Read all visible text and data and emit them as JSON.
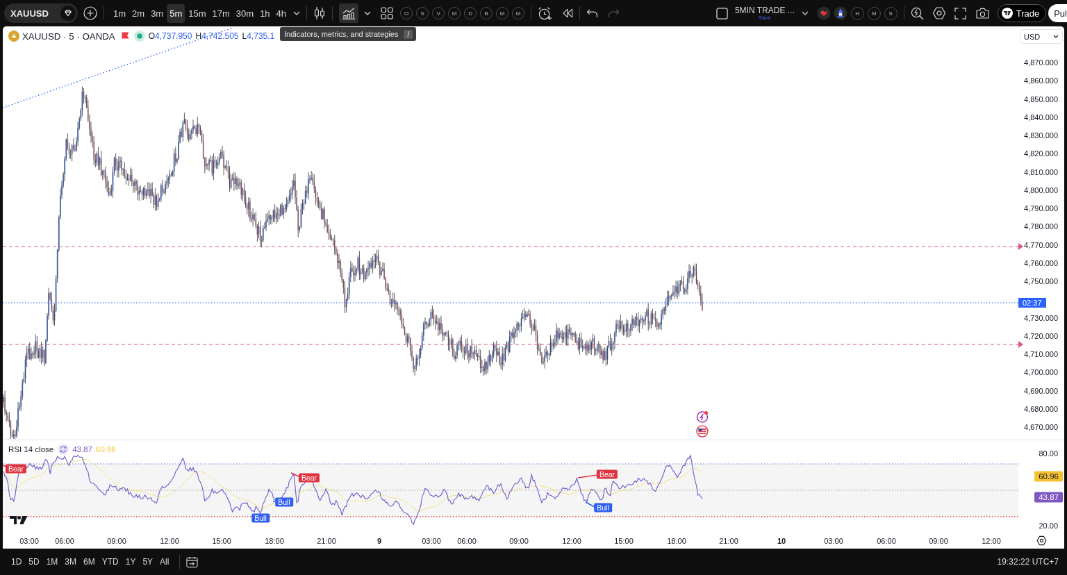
{
  "toolbar": {
    "symbol": "XAUUSD",
    "intervals": [
      {
        "label": "1m",
        "selected": false
      },
      {
        "label": "2m",
        "selected": false
      },
      {
        "label": "3m",
        "selected": false
      },
      {
        "label": "5m",
        "selected": true
      },
      {
        "label": "15m",
        "selected": false
      },
      {
        "label": "17m",
        "selected": false
      },
      {
        "label": "30m",
        "selected": false
      },
      {
        "label": "1h",
        "selected": false
      },
      {
        "label": "4h",
        "selected": false
      }
    ],
    "indicators": {
      "hovered": true
    },
    "favorites": [
      "O",
      "S",
      "V",
      "M",
      "D",
      "B",
      "M",
      "M"
    ],
    "history": {
      "undo_disabled": false,
      "redo_disabled": true
    },
    "layout": {
      "name": "5MIN TRADE ...",
      "status": "Save"
    },
    "profiles": [
      "H",
      "M",
      "S"
    ],
    "trade_button": "Trade",
    "publish_button": "Pul"
  },
  "tooltip": {
    "text": "Indicators, metrics, and strategies",
    "shortcut": "/"
  },
  "legend": {
    "title": "XAUUSD · 5 · OANDA",
    "market_open": true,
    "ohlc": [
      {
        "key": "O",
        "value": "4,737.950"
      },
      {
        "key": "H",
        "value": "4,742.505"
      },
      {
        "key": "L",
        "value": "4,735.1"
      }
    ]
  },
  "currency": "USD",
  "price_axis": {
    "labels": [
      "4,870.000",
      "4,860.000",
      "4,850.000",
      "4,840.000",
      "4,830.000",
      "4,820.000",
      "4,810.000",
      "4,800.000",
      "4,790.000",
      "4,780.000",
      "4,770.000",
      "4,760.000",
      "4,750.000",
      "4,730.000",
      "4,720.000",
      "4,710.000",
      "4,700.000",
      "4,690.000",
      "4,680.000",
      "4,670.000"
    ],
    "countdown": "02:37"
  },
  "rsi": {
    "title": "RSI 14 close",
    "values": [
      {
        "text": "43.87",
        "color": "#7e57c2"
      },
      {
        "text": "60.96",
        "color": "#f2c230"
      }
    ],
    "axis": [
      {
        "text": "80.00",
        "kind": "tick"
      },
      {
        "text": "60.96",
        "kind": "value",
        "color": "#f2c230"
      },
      {
        "text": "43.87",
        "kind": "value",
        "color": "#7e57c2"
      },
      {
        "text": "20.00",
        "kind": "tick"
      }
    ],
    "signals": [
      {
        "label": "Bear",
        "kind": "bear"
      },
      {
        "label": "Bull",
        "kind": "bull"
      },
      {
        "label": "Bull",
        "kind": "bull"
      },
      {
        "label": "Bear",
        "kind": "bear"
      },
      {
        "label": "Bull",
        "kind": "bull"
      },
      {
        "label": "Bear",
        "kind": "bear"
      }
    ]
  },
  "time_axis": [
    {
      "text": "03:00",
      "kind": "time"
    },
    {
      "text": "06:00",
      "kind": "time"
    },
    {
      "text": "09:00",
      "kind": "time"
    },
    {
      "text": "12:00",
      "kind": "time"
    },
    {
      "text": "15:00",
      "kind": "time"
    },
    {
      "text": "18:00",
      "kind": "time"
    },
    {
      "text": "21:00",
      "kind": "time"
    },
    {
      "text": "9",
      "kind": "day"
    },
    {
      "text": "03:00",
      "kind": "time"
    },
    {
      "text": "06:00",
      "kind": "time"
    },
    {
      "text": "09:00",
      "kind": "time"
    },
    {
      "text": "12:00",
      "kind": "time"
    },
    {
      "text": "15:00",
      "kind": "time"
    },
    {
      "text": "18:00",
      "kind": "time"
    },
    {
      "text": "21:00",
      "kind": "time"
    },
    {
      "text": "10",
      "kind": "day"
    },
    {
      "text": "03:00",
      "kind": "time"
    },
    {
      "text": "06:00",
      "kind": "time"
    },
    {
      "text": "09:00",
      "kind": "time"
    },
    {
      "text": "12:00",
      "kind": "time"
    }
  ],
  "range_bar": {
    "ranges": [
      "1D",
      "5D",
      "1M",
      "3M",
      "6M",
      "YTD",
      "1Y",
      "5Y",
      "All"
    ],
    "clock": "19:32:22 UTC+7"
  }
}
